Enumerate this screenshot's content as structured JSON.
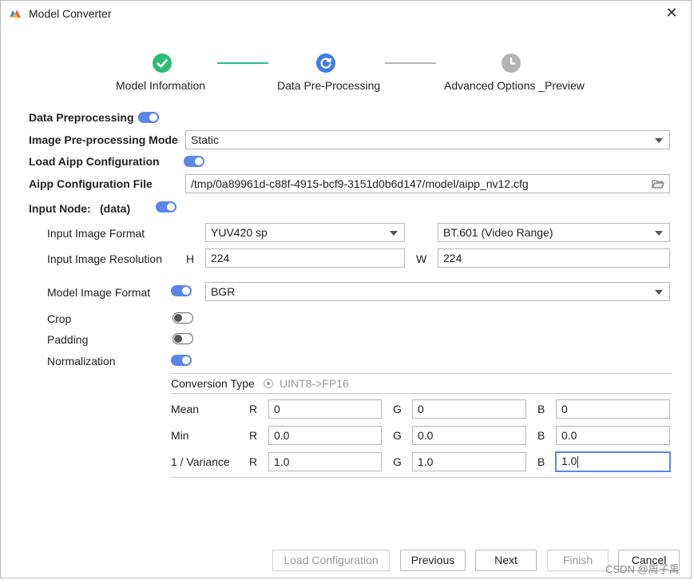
{
  "window": {
    "title": "Model Converter",
    "close_label": "✕"
  },
  "steps": [
    {
      "label": "Model Information",
      "state": "done"
    },
    {
      "label": "Data Pre-Processing",
      "state": "current"
    },
    {
      "label": "Advanced Options _Preview",
      "state": "pending"
    }
  ],
  "colors": {
    "done": "#2ebd73",
    "current": "#3d7ce8",
    "pending": "#b3b3b3",
    "toggle_on": "#5b86e5"
  },
  "form": {
    "data_preprocessing": {
      "label": "Data Preprocessing",
      "on": true
    },
    "mode": {
      "label": "Image Pre-processing Mode",
      "value": "Static"
    },
    "load_aipp": {
      "label": "Load Aipp Configuration",
      "on": true
    },
    "aipp_file": {
      "label": "Aipp Configuration File",
      "value": "/tmp/0a89961d-c88f-4915-bcf9-3151d0b6d147/model/aipp_nv12.cfg"
    },
    "input_node": {
      "label": "Input Node:",
      "name": "(data)",
      "on": true
    },
    "input_format": {
      "label": "Input Image Format",
      "format": "YUV420 sp",
      "range": "BT.601 (Video Range)"
    },
    "resolution": {
      "label": "Input Image Resolution",
      "h_label": "H",
      "h": "224",
      "w_label": "W",
      "w": "224"
    },
    "model_format": {
      "label": "Model Image Format",
      "on": true,
      "value": "BGR"
    },
    "crop": {
      "label": "Crop",
      "on": false
    },
    "padding": {
      "label": "Padding",
      "on": false
    },
    "normalization": {
      "label": "Normalization",
      "on": true
    },
    "conversion": {
      "label": "Conversion Type",
      "option": "UINT8->FP16"
    },
    "channels": {
      "r": "R",
      "g": "G",
      "b": "B"
    },
    "rows": [
      {
        "label": "Mean",
        "r": "0",
        "g": "0",
        "b": "0"
      },
      {
        "label": "Min",
        "r": "0.0",
        "g": "0.0",
        "b": "0.0"
      },
      {
        "label": "1 / Variance",
        "r": "1.0",
        "g": "1.0",
        "b": "1.0"
      }
    ]
  },
  "buttons": {
    "load_config": "Load Configuration",
    "previous": "Previous",
    "next": "Next",
    "finish": "Finish",
    "cancel": "Cancel"
  },
  "watermark": "CSDN @周子禹"
}
